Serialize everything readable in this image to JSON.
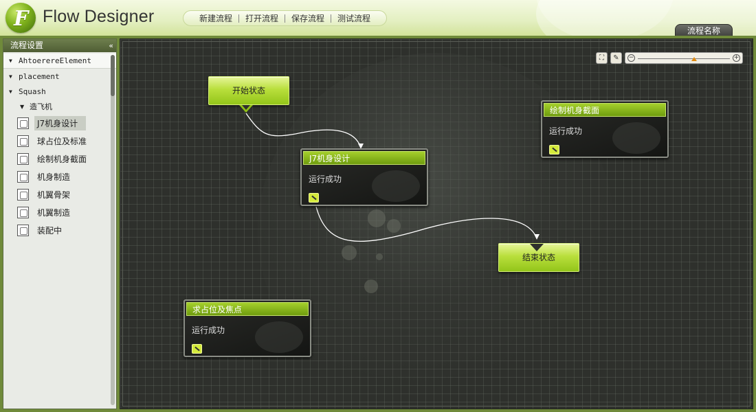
{
  "app": {
    "title": "Flow Designer"
  },
  "toolbar": {
    "new": "新建流程",
    "open": "打开流程",
    "save": "保存流程",
    "test": "测试流程"
  },
  "flow_tab": "流程名称",
  "sidebar": {
    "header": "流程设置",
    "collapse": "«",
    "tree": [
      {
        "label": "AhtoerereElement",
        "expanded": true
      },
      {
        "label": "placement",
        "expanded": true
      },
      {
        "label": "Squash",
        "expanded": true
      },
      {
        "label": "造飞机",
        "expanded": true
      }
    ],
    "leaves": [
      {
        "label": "J7机身设计",
        "selected": true
      },
      {
        "label": "球占位及标准",
        "selected": false
      },
      {
        "label": "绘制机身截面",
        "selected": false
      },
      {
        "label": "机身制造",
        "selected": false
      },
      {
        "label": "机翼骨架",
        "selected": false
      },
      {
        "label": "机翼制造",
        "selected": false
      },
      {
        "label": "装配中",
        "selected": false
      }
    ]
  },
  "canvas": {
    "start_node": "开始状态",
    "end_node": "结束状态",
    "tasks": [
      {
        "title": "J7机身设计",
        "status": "运行成功"
      },
      {
        "title": "绘制机身截面",
        "status": "运行成功"
      },
      {
        "title": "求占位及焦点",
        "status": "运行成功"
      }
    ],
    "zoom": {
      "level": 0.6
    }
  }
}
